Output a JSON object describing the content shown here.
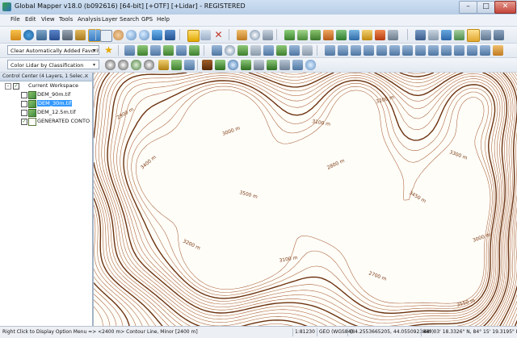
{
  "window": {
    "title": "Global Mapper v18.0 (b092616) [64-bit] [+OTF] [+Lidar] - REGISTERED",
    "minimize_label": "–",
    "maximize_label": "□",
    "close_label": "✕"
  },
  "menu": {
    "items": [
      "File",
      "Edit",
      "View",
      "Tools",
      "Analysis",
      "Layer",
      "Search",
      "GPS",
      "Help"
    ]
  },
  "toolbar": {
    "favorites_combo": "Clear Automatically Added Favorites",
    "lidar_combo": "Color Lidar by Classification",
    "dropdown_arrow": "▾"
  },
  "control_center": {
    "title": "Control Center (4 Layers, 1 Selec...",
    "close_label": "×",
    "workspace_label": "Current Workspace",
    "expander_label": "–",
    "check_mark": "✓",
    "layers": [
      {
        "name": "DEM_90m.tif",
        "checked": false,
        "selected": false
      },
      {
        "name": "DEM_30m.tif",
        "checked": false,
        "selected": true
      },
      {
        "name": "DEM_12.5m.tif",
        "checked": false,
        "selected": false
      },
      {
        "name": "GENERATED CONTO",
        "checked": true,
        "selected": false
      }
    ]
  },
  "map": {
    "contour_labels": [
      "2900 m",
      "3000 m",
      "3100 m",
      "3200 m",
      "3300 m",
      "3400 m",
      "3500 m",
      "2800 m",
      "3450 m",
      "3000 m",
      "3200 m",
      "3100 m",
      "2700 m",
      "3550 m"
    ]
  },
  "status": {
    "hint": "Right Click to Display Option Menu => <2400 m> Contour Line, Minor [2400 m]",
    "scale": "1:81230",
    "projection": "GEO (WGS84)",
    "coords": "(84.2553665205, 44.0550923889)",
    "dms": "44° 03' 18.3326\" N, 84° 15' 19.3195\" E"
  },
  "colors": {
    "contour_major": "#6b3210",
    "contour_minor": "#a7603a",
    "map_bg": "#fffdf8",
    "selection": "#3399ff"
  }
}
